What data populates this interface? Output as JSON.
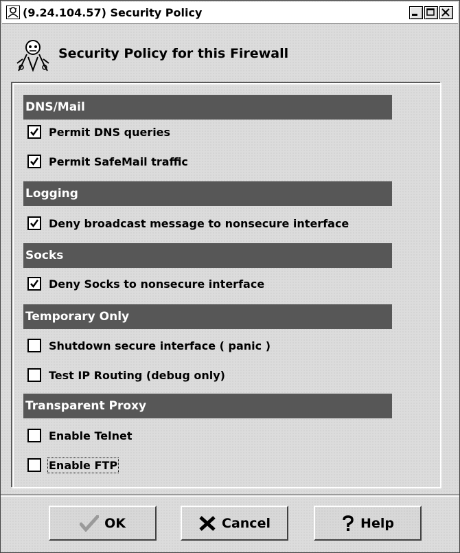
{
  "window": {
    "title": "(9.24.104.57) Security Policy"
  },
  "header": {
    "title": "Security Policy for this Firewall"
  },
  "sections": [
    {
      "label": "DNS/Mail",
      "options": [
        {
          "label": "Permit DNS queries",
          "checked": true
        },
        {
          "label": "Permit SafeMail traffic",
          "checked": true
        }
      ]
    },
    {
      "label": "Logging",
      "options": [
        {
          "label": "Deny broadcast message to nonsecure interface",
          "checked": true
        }
      ]
    },
    {
      "label": "Socks",
      "options": [
        {
          "label": "Deny Socks to nonsecure interface",
          "checked": true
        }
      ]
    },
    {
      "label": "Temporary Only",
      "options": [
        {
          "label": "Shutdown secure interface ( panic )",
          "checked": false
        },
        {
          "label": "Test IP Routing (debug only)",
          "checked": false
        }
      ]
    },
    {
      "label": "Transparent Proxy",
      "options": [
        {
          "label": "Enable Telnet",
          "checked": false
        },
        {
          "label": "Enable FTP",
          "checked": false
        }
      ]
    }
  ],
  "buttons": {
    "ok": "OK",
    "cancel": "Cancel",
    "help": "Help"
  },
  "icons": {
    "window": "app-logo-icon",
    "header": "security-agent-icon",
    "ok": "checkmark-icon",
    "cancel": "x-icon",
    "help": "question-icon"
  }
}
